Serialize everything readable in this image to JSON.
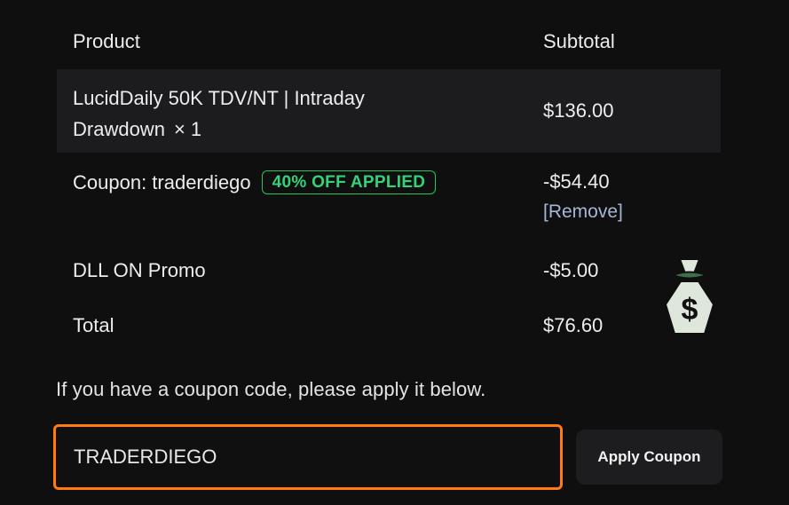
{
  "order_table": {
    "header": {
      "product": "Product",
      "subtotal": "Subtotal"
    },
    "product": {
      "name_line1": "LucidDaily 50K TDV/NT | Intraday",
      "name_line2": "Drawdown",
      "quantity": "× 1",
      "price": "$136.00"
    },
    "coupon": {
      "label": "Coupon: traderdiego",
      "badge": "40% OFF APPLIED",
      "amount": "-$54.40",
      "remove": "[Remove]"
    },
    "promo": {
      "label": "DLL ON Promo",
      "amount": "-$5.00"
    },
    "total": {
      "label": "Total",
      "amount": "$76.60"
    }
  },
  "coupon_form": {
    "hint": "If you have a coupon code, please apply it below.",
    "input_value": "TRADERDIEGO",
    "apply_label": "Apply Coupon"
  },
  "icons": {
    "money_bag": "money-bag-icon"
  },
  "colors": {
    "badge_green": "#22c55e",
    "input_focus_orange": "#ff7a10",
    "remove_link": "#a7b6d6",
    "background": "#0f0f10"
  }
}
